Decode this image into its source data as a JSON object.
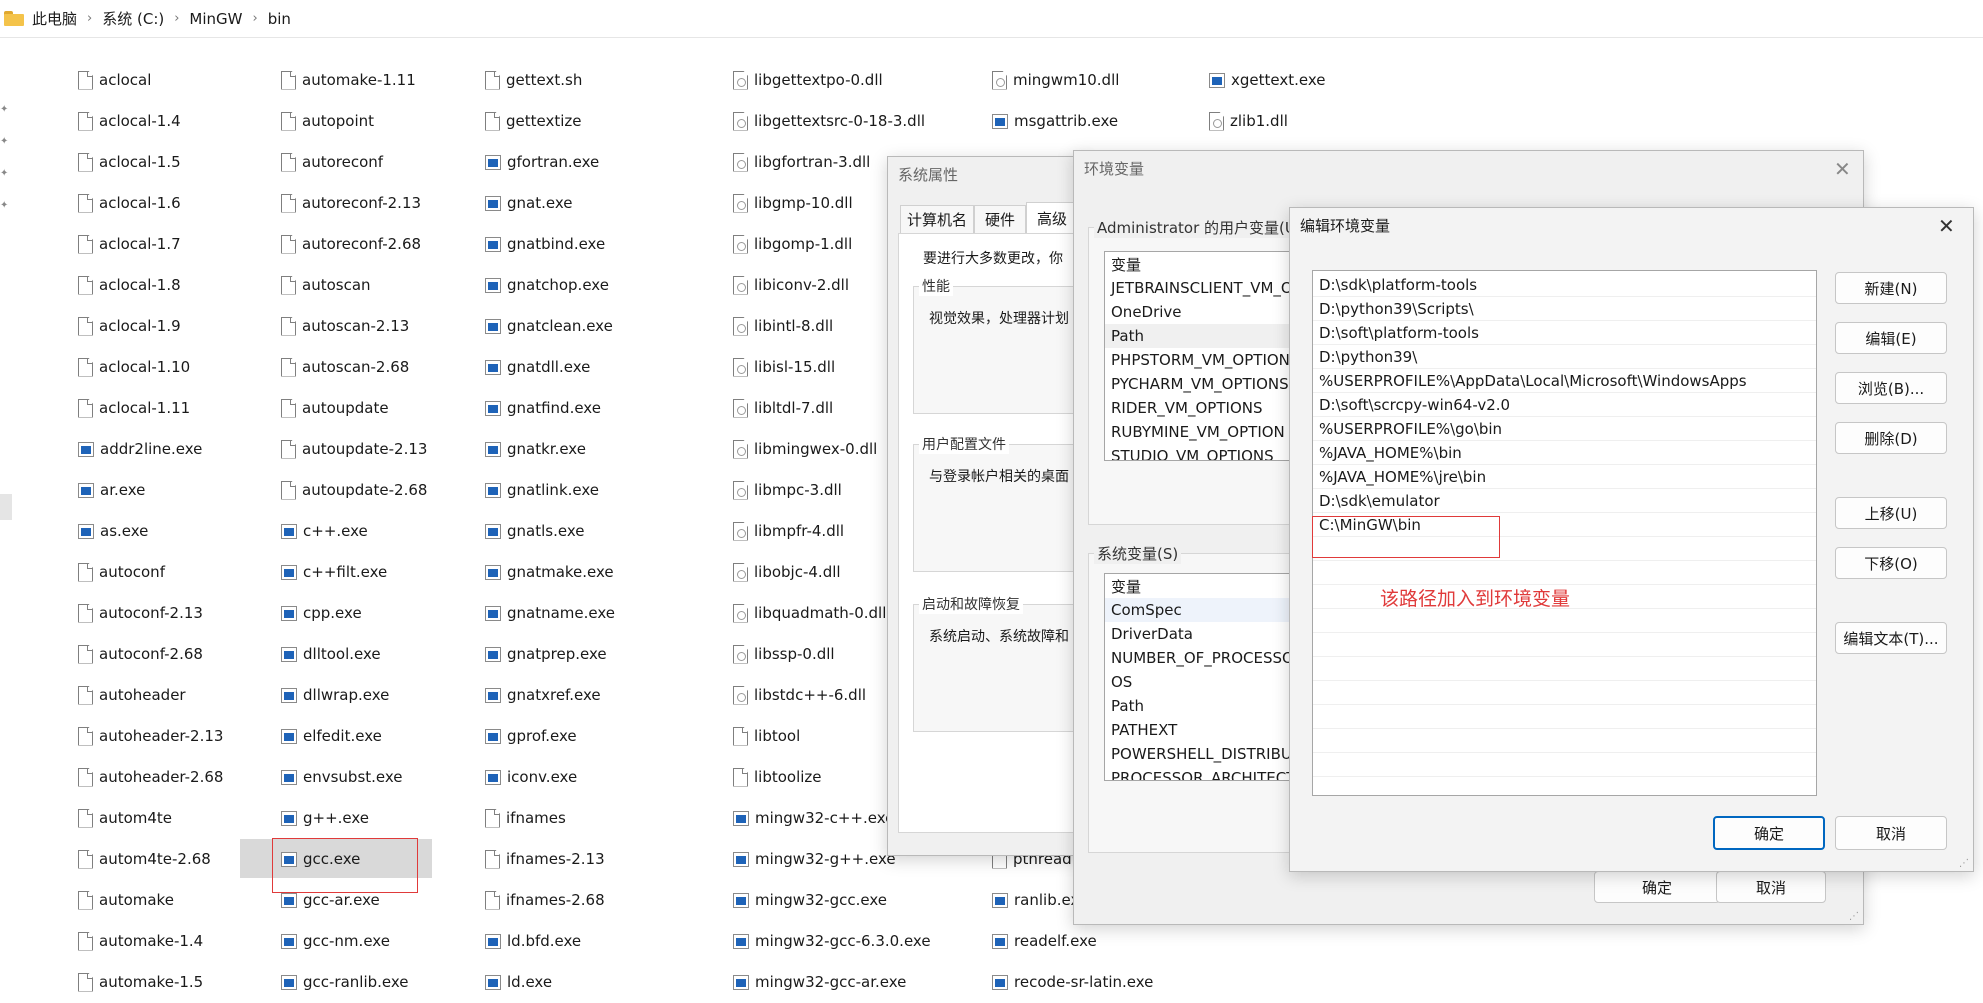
{
  "breadcrumb": [
    "此电脑",
    "系统 (C:)",
    "MinGW",
    "bin"
  ],
  "files": {
    "col1": [
      {
        "name": "aclocal",
        "type": "doc"
      },
      {
        "name": "aclocal-1.4",
        "type": "doc"
      },
      {
        "name": "aclocal-1.5",
        "type": "doc"
      },
      {
        "name": "aclocal-1.6",
        "type": "doc"
      },
      {
        "name": "aclocal-1.7",
        "type": "doc"
      },
      {
        "name": "aclocal-1.8",
        "type": "doc"
      },
      {
        "name": "aclocal-1.9",
        "type": "doc"
      },
      {
        "name": "aclocal-1.10",
        "type": "doc"
      },
      {
        "name": "aclocal-1.11",
        "type": "doc"
      },
      {
        "name": "addr2line.exe",
        "type": "exe"
      },
      {
        "name": "ar.exe",
        "type": "exe"
      },
      {
        "name": "as.exe",
        "type": "exe"
      },
      {
        "name": "autoconf",
        "type": "doc"
      },
      {
        "name": "autoconf-2.13",
        "type": "doc"
      },
      {
        "name": "autoconf-2.68",
        "type": "doc"
      },
      {
        "name": "autoheader",
        "type": "doc"
      },
      {
        "name": "autoheader-2.13",
        "type": "doc"
      },
      {
        "name": "autoheader-2.68",
        "type": "doc"
      },
      {
        "name": "autom4te",
        "type": "doc"
      },
      {
        "name": "autom4te-2.68",
        "type": "doc"
      },
      {
        "name": "automake",
        "type": "doc"
      },
      {
        "name": "automake-1.4",
        "type": "doc"
      },
      {
        "name": "automake-1.5",
        "type": "doc"
      }
    ],
    "col2": [
      {
        "name": "automake-1.11",
        "type": "doc"
      },
      {
        "name": "autopoint",
        "type": "doc"
      },
      {
        "name": "autoreconf",
        "type": "doc"
      },
      {
        "name": "autoreconf-2.13",
        "type": "doc"
      },
      {
        "name": "autoreconf-2.68",
        "type": "doc"
      },
      {
        "name": "autoscan",
        "type": "doc"
      },
      {
        "name": "autoscan-2.13",
        "type": "doc"
      },
      {
        "name": "autoscan-2.68",
        "type": "doc"
      },
      {
        "name": "autoupdate",
        "type": "doc"
      },
      {
        "name": "autoupdate-2.13",
        "type": "doc"
      },
      {
        "name": "autoupdate-2.68",
        "type": "doc"
      },
      {
        "name": "c++.exe",
        "type": "exe"
      },
      {
        "name": "c++filt.exe",
        "type": "exe"
      },
      {
        "name": "cpp.exe",
        "type": "exe"
      },
      {
        "name": "dlltool.exe",
        "type": "exe"
      },
      {
        "name": "dllwrap.exe",
        "type": "exe"
      },
      {
        "name": "elfedit.exe",
        "type": "exe"
      },
      {
        "name": "envsubst.exe",
        "type": "exe"
      },
      {
        "name": "g++.exe",
        "type": "exe"
      },
      {
        "name": "gcc.exe",
        "type": "exe"
      },
      {
        "name": "gcc-ar.exe",
        "type": "exe"
      },
      {
        "name": "gcc-nm.exe",
        "type": "exe"
      },
      {
        "name": "gcc-ranlib.exe",
        "type": "exe"
      }
    ],
    "col3": [
      {
        "name": "gettext.sh",
        "type": "doc"
      },
      {
        "name": "gettextize",
        "type": "doc"
      },
      {
        "name": "gfortran.exe",
        "type": "exe"
      },
      {
        "name": "gnat.exe",
        "type": "exe"
      },
      {
        "name": "gnatbind.exe",
        "type": "exe"
      },
      {
        "name": "gnatchop.exe",
        "type": "exe"
      },
      {
        "name": "gnatclean.exe",
        "type": "exe"
      },
      {
        "name": "gnatdll.exe",
        "type": "exe"
      },
      {
        "name": "gnatfind.exe",
        "type": "exe"
      },
      {
        "name": "gnatkr.exe",
        "type": "exe"
      },
      {
        "name": "gnatlink.exe",
        "type": "exe"
      },
      {
        "name": "gnatls.exe",
        "type": "exe"
      },
      {
        "name": "gnatmake.exe",
        "type": "exe"
      },
      {
        "name": "gnatname.exe",
        "type": "exe"
      },
      {
        "name": "gnatprep.exe",
        "type": "exe"
      },
      {
        "name": "gnatxref.exe",
        "type": "exe"
      },
      {
        "name": "gprof.exe",
        "type": "exe"
      },
      {
        "name": "iconv.exe",
        "type": "exe"
      },
      {
        "name": "ifnames",
        "type": "doc"
      },
      {
        "name": "ifnames-2.13",
        "type": "doc"
      },
      {
        "name": "ifnames-2.68",
        "type": "doc"
      },
      {
        "name": "ld.bfd.exe",
        "type": "exe"
      },
      {
        "name": "ld.exe",
        "type": "exe"
      }
    ],
    "col4": [
      {
        "name": "libgettextpo-0.dll",
        "type": "dll"
      },
      {
        "name": "libgettextsrc-0-18-3.dll",
        "type": "dll"
      },
      {
        "name": "libgfortran-3.dll",
        "type": "dll"
      },
      {
        "name": "libgmp-10.dll",
        "type": "dll"
      },
      {
        "name": "libgomp-1.dll",
        "type": "dll"
      },
      {
        "name": "libiconv-2.dll",
        "type": "dll"
      },
      {
        "name": "libintl-8.dll",
        "type": "dll"
      },
      {
        "name": "libisl-15.dll",
        "type": "dll"
      },
      {
        "name": "libltdl-7.dll",
        "type": "dll"
      },
      {
        "name": "libmingwex-0.dll",
        "type": "dll"
      },
      {
        "name": "libmpc-3.dll",
        "type": "dll"
      },
      {
        "name": "libmpfr-4.dll",
        "type": "dll"
      },
      {
        "name": "libobjc-4.dll",
        "type": "dll"
      },
      {
        "name": "libquadmath-0.dll",
        "type": "dll"
      },
      {
        "name": "libssp-0.dll",
        "type": "dll"
      },
      {
        "name": "libstdc++-6.dll",
        "type": "dll"
      },
      {
        "name": "libtool",
        "type": "doc"
      },
      {
        "name": "libtoolize",
        "type": "doc"
      },
      {
        "name": "mingw32-c++.exe",
        "type": "exe"
      },
      {
        "name": "mingw32-g++.exe",
        "type": "exe"
      },
      {
        "name": "mingw32-gcc.exe",
        "type": "exe"
      },
      {
        "name": "mingw32-gcc-6.3.0.exe",
        "type": "exe"
      },
      {
        "name": "mingw32-gcc-ar.exe",
        "type": "exe"
      }
    ],
    "col5": [
      {
        "name": "mingwm10.dll",
        "type": "dll",
        "row": 0
      },
      {
        "name": "msgattrib.exe",
        "type": "exe",
        "row": 1
      },
      {
        "name": "pthread",
        "type": "doc",
        "row": 19
      },
      {
        "name": "ranlib.ex",
        "type": "exe",
        "row": 20
      },
      {
        "name": "readelf.exe",
        "type": "exe",
        "row": 21
      },
      {
        "name": "recode-sr-latin.exe",
        "type": "exe",
        "row": 22
      }
    ],
    "col6": [
      {
        "name": "xgettext.exe",
        "type": "exe",
        "row": 0
      },
      {
        "name": "zlib1.dll",
        "type": "dll",
        "row": 1
      }
    ]
  },
  "sysprops": {
    "title": "系统属性",
    "tabs": [
      "计算机名",
      "硬件",
      "高级"
    ],
    "intro": "要进行大多数更改，你",
    "perf_label": "性能",
    "perf_text": "视觉效果，处理器计划",
    "profile_label": "用户配置文件",
    "profile_text": "与登录帐户相关的桌面",
    "startup_label": "启动和故障恢复",
    "startup_text": "系统启动、系统故障和"
  },
  "envvars": {
    "title": "环境变量",
    "user_label": "Administrator 的用户变量(U",
    "col_header": "变量",
    "user_vars": [
      "JETBRAINSCLIENT_VM_O",
      "OneDrive",
      "Path",
      "PHPSTORM_VM_OPTION",
      "PYCHARM_VM_OPTIONS",
      "RIDER_VM_OPTIONS",
      "RUBYMINE_VM_OPTION",
      "STUDIO_VM_OPTIONS"
    ],
    "sys_label": "系统变量(S)",
    "sys_vars": [
      "ComSpec",
      "DriverData",
      "NUMBER_OF_PROCESSO",
      "OS",
      "Path",
      "PATHEXT",
      "POWERSHELL_DISTRIBUT",
      "PROCESSOR_ARCHITECT"
    ],
    "ok": "确定",
    "cancel": "取消"
  },
  "editenv": {
    "title": "编辑环境变量",
    "paths": [
      "D:\\sdk\\platform-tools",
      "D:\\python39\\Scripts\\",
      "D:\\soft\\platform-tools",
      "D:\\python39\\",
      "%USERPROFILE%\\AppData\\Local\\Microsoft\\WindowsApps",
      "D:\\soft\\scrcpy-win64-v2.0",
      "%USERPROFILE%\\go\\bin",
      "%JAVA_HOME%\\bin",
      "%JAVA_HOME%\\jre\\bin",
      "D:\\sdk\\emulator",
      "C:\\MinGW\\bin"
    ],
    "annotation": "该路径加入到环境变量",
    "buttons": {
      "new": "新建(N)",
      "edit": "编辑(E)",
      "browse": "浏览(B)...",
      "delete": "删除(D)",
      "up": "上移(U)",
      "down": "下移(O)",
      "edit_text": "编辑文本(T)..."
    },
    "ok": "确定",
    "cancel": "取消"
  },
  "colors": {
    "annotation_red": "#e03a3a",
    "primary_blue": "#0067c0",
    "exe_icon_blue": "#1e63b8"
  }
}
